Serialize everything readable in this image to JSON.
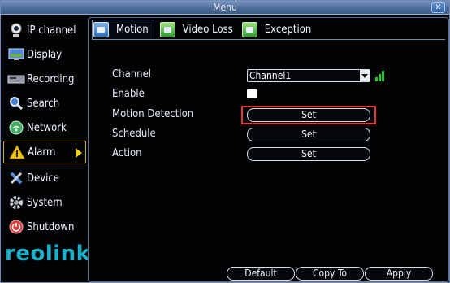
{
  "window": {
    "title": "Menu"
  },
  "sidebar": {
    "items": [
      {
        "label": "IP channel",
        "icon": "webcam-icon"
      },
      {
        "label": "Display",
        "icon": "monitor-icon"
      },
      {
        "label": "Recording",
        "icon": "recorder-icon"
      },
      {
        "label": "Search",
        "icon": "magnifier-icon"
      },
      {
        "label": "Network",
        "icon": "network-icon"
      },
      {
        "label": "Alarm",
        "icon": "warning-icon",
        "active": true
      },
      {
        "label": "Device",
        "icon": "tools-icon"
      },
      {
        "label": "System",
        "icon": "gear-icon"
      },
      {
        "label": "Shutdown",
        "icon": "power-icon"
      }
    ],
    "logo": "reolink"
  },
  "tabs": [
    {
      "label": "Motion",
      "active": true
    },
    {
      "label": "Video Loss"
    },
    {
      "label": "Exception"
    }
  ],
  "form": {
    "channel_label": "Channel",
    "channel_value": "Channel1",
    "enable_label": "Enable",
    "enable_checked": false,
    "motion_label": "Motion Detection",
    "schedule_label": "Schedule",
    "action_label": "Action",
    "set_label": "Set"
  },
  "footer": {
    "default_label": "Default",
    "copy_label": "Copy To",
    "apply_label": "Apply"
  },
  "colors": {
    "accent_logo": "#1fb0c9",
    "highlight": "#e23a2f",
    "alarm_arrow": "#f1d21c"
  }
}
